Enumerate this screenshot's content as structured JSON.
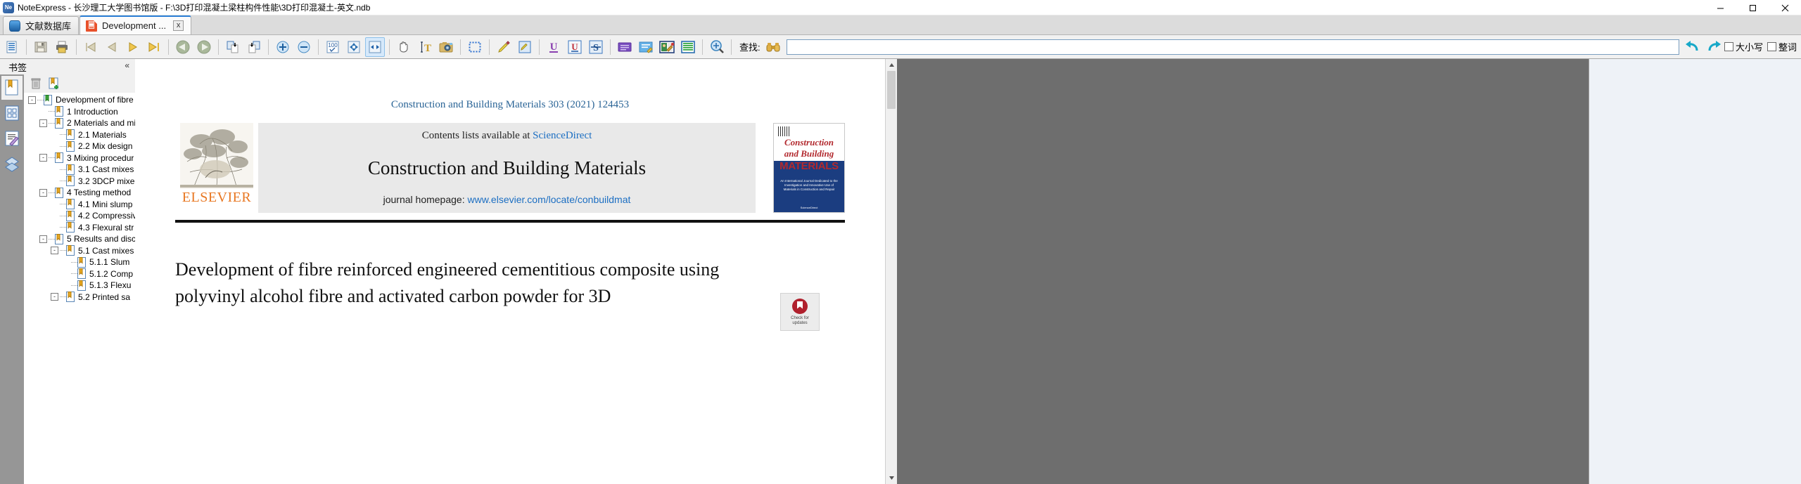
{
  "window": {
    "title": "NoteExpress - 长沙理工大学图书馆版 - F:\\3D打印混凝土梁柱构件性能\\3D打印混凝土-英文.ndb",
    "app_icon": "noteexpress-icon",
    "minimize": "minimize-icon",
    "maximize": "maximize-icon",
    "close": "close-icon"
  },
  "tabs": [
    {
      "label": "文献数据库",
      "icon": "database-icon",
      "active": false,
      "closable": false
    },
    {
      "label": "Development ...",
      "icon": "pdf-icon",
      "active": true,
      "closable": true,
      "close_label": "x"
    }
  ],
  "toolbar": {
    "buttons": [
      {
        "name": "document-properties-icon",
        "title": "文档"
      },
      {
        "name": "save-icon",
        "title": "保存"
      },
      {
        "name": "print-icon",
        "title": "打印"
      },
      {
        "name": "first-page-icon",
        "title": "首页"
      },
      {
        "name": "previous-page-icon",
        "title": "上一页"
      },
      {
        "name": "next-page-icon",
        "title": "下一页"
      },
      {
        "name": "last-page-icon",
        "title": "末页"
      },
      {
        "name": "navigate-back-icon",
        "title": "后退"
      },
      {
        "name": "navigate-forward-icon",
        "title": "前进"
      },
      {
        "name": "previous-view-icon",
        "title": "上一视图"
      },
      {
        "name": "next-view-icon",
        "title": "下一视图"
      },
      {
        "name": "zoom-in-icon",
        "title": "放大"
      },
      {
        "name": "zoom-out-icon",
        "title": "缩小"
      },
      {
        "name": "actual-size-icon",
        "title": "100%"
      },
      {
        "name": "fit-page-icon",
        "title": "适合页面"
      },
      {
        "name": "fit-width-icon",
        "title": "适合宽度"
      },
      {
        "name": "hand-tool-icon",
        "title": "手形工具"
      },
      {
        "name": "select-text-icon",
        "title": "选择文本"
      },
      {
        "name": "snapshot-icon",
        "title": "快照"
      },
      {
        "name": "select-area-icon",
        "title": "选择区域"
      },
      {
        "name": "highlight-icon",
        "title": "高亮"
      },
      {
        "name": "highlight-area-icon",
        "title": "区域高亮"
      },
      {
        "name": "underline-icon",
        "title": "下划线"
      },
      {
        "name": "underline-boxed-icon",
        "title": "下划线框"
      },
      {
        "name": "strikethrough-icon",
        "title": "删除线"
      },
      {
        "name": "sticky-note-icon",
        "title": "便签"
      },
      {
        "name": "text-box-icon",
        "title": "文本框"
      },
      {
        "name": "stamp-icon",
        "title": "图章"
      },
      {
        "name": "line-highlight-icon",
        "title": "逐行高亮"
      },
      {
        "name": "search-icon",
        "title": "搜索"
      }
    ],
    "selected_button": "fit-width-icon",
    "find_label": "查找:",
    "find_icon": "binoculars-icon",
    "find_value": "",
    "find_placeholder": "",
    "find_prev_icon": "find-previous-icon",
    "find_next_icon": "find-next-icon",
    "match_case_label": "大小写",
    "whole_word_label": "整词",
    "match_case_checked": false,
    "whole_word_checked": false
  },
  "bookmarks_panel": {
    "title": "书签",
    "collapse_icon": "collapse-panel-icon",
    "rail": [
      {
        "name": "sidebar-tab-bookmarks",
        "icon": "bookmark-page-icon",
        "active": true
      },
      {
        "name": "sidebar-tab-thumbnails",
        "icon": "thumbnails-icon",
        "active": false
      },
      {
        "name": "sidebar-tab-annotations",
        "icon": "annotations-icon",
        "active": false
      },
      {
        "name": "sidebar-tab-layers",
        "icon": "layers-icon",
        "active": false
      }
    ],
    "tools": [
      {
        "name": "delete-bookmark-button",
        "icon": "trash-icon"
      },
      {
        "name": "add-bookmark-button",
        "icon": "add-bookmark-icon"
      }
    ],
    "tree": [
      {
        "label": "Development of fibre",
        "depth": 0,
        "expander": "-",
        "root": true
      },
      {
        "label": "1 Introduction",
        "depth": 1,
        "expander": ""
      },
      {
        "label": "2 Materials and mi",
        "depth": 1,
        "expander": "-"
      },
      {
        "label": "2.1 Materials",
        "depth": 2,
        "expander": ""
      },
      {
        "label": "2.2 Mix design",
        "depth": 2,
        "expander": ""
      },
      {
        "label": "3 Mixing procedur",
        "depth": 1,
        "expander": "-"
      },
      {
        "label": "3.1 Cast mixes",
        "depth": 2,
        "expander": ""
      },
      {
        "label": "3.2 3DCP mixe",
        "depth": 2,
        "expander": ""
      },
      {
        "label": "4 Testing method",
        "depth": 1,
        "expander": "-"
      },
      {
        "label": "4.1 Mini slump",
        "depth": 2,
        "expander": ""
      },
      {
        "label": "4.2 Compressiv",
        "depth": 2,
        "expander": ""
      },
      {
        "label": "4.3 Flexural str",
        "depth": 2,
        "expander": ""
      },
      {
        "label": "5 Results and disc",
        "depth": 1,
        "expander": "-"
      },
      {
        "label": "5.1 Cast mixes",
        "depth": 2,
        "expander": "-"
      },
      {
        "label": "5.1.1 Slum",
        "depth": 3,
        "expander": ""
      },
      {
        "label": "5.1.2 Comp",
        "depth": 3,
        "expander": ""
      },
      {
        "label": "5.1.3 Flexu",
        "depth": 3,
        "expander": ""
      },
      {
        "label": "5.2 Printed sa",
        "depth": 2,
        "expander": "-"
      }
    ]
  },
  "document": {
    "running_head": "Construction and Building Materials 303 (2021) 124453",
    "publisher": "ELSEVIER",
    "contents_prefix": "Contents lists available at",
    "contents_link": "ScienceDirect",
    "journal_title": "Construction and Building Materials",
    "homepage_label": "journal homepage:",
    "homepage_url": "www.elsevier.com/locate/conbuildmat",
    "cover": {
      "line1": "Construction",
      "line2": "and Building",
      "line3": "MATERIALS",
      "blurb": "An International Journal Dedicated to the Investigation and Innovative Use of Materials in Construction and Repair",
      "foot": "ScienceDirect"
    },
    "article_title_line1": "Development of fibre reinforced engineered cementitious composite using",
    "article_title_line2": "polyvinyl alcohol fibre and activated carbon powder for 3D",
    "crossmark": {
      "label_line1": "Check for",
      "label_line2": "updates"
    }
  },
  "scrollbar": {
    "up_icon": "scroll-up-icon",
    "down_icon": "scroll-down-icon"
  }
}
